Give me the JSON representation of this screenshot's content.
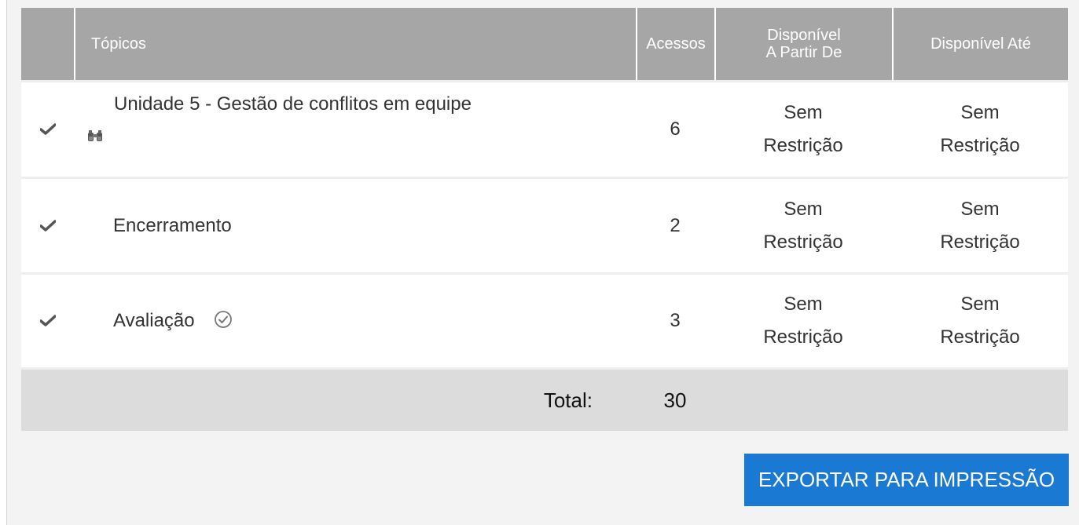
{
  "table": {
    "headers": {
      "topics": "Tópicos",
      "accesses": "Acessos",
      "available_from": "Disponível\nA Partir De",
      "available_until": "Disponível Até"
    },
    "rows": [
      {
        "topic": "Unidade 5 - Gestão de conflitos em equipe",
        "icon": "binoculars-icon",
        "accesses": "6",
        "from": "Sem Restrição",
        "until": "Sem Restrição"
      },
      {
        "topic": "Encerramento",
        "accesses": "2",
        "from": "Sem Restrição",
        "until": "Sem Restrição"
      },
      {
        "topic": "Avaliação",
        "icon": "circle-check-icon",
        "accesses": "3",
        "from": "Sem Restrição",
        "until": "Sem Restrição"
      }
    ],
    "total_label": "Total:",
    "total_value": "30"
  },
  "export_button": "EXPORTAR PARA IMPRESSÃO",
  "colors": {
    "header_bg": "#a6a6a6",
    "total_bg": "#dcdcdc",
    "button_bg": "#1a7ad3"
  }
}
